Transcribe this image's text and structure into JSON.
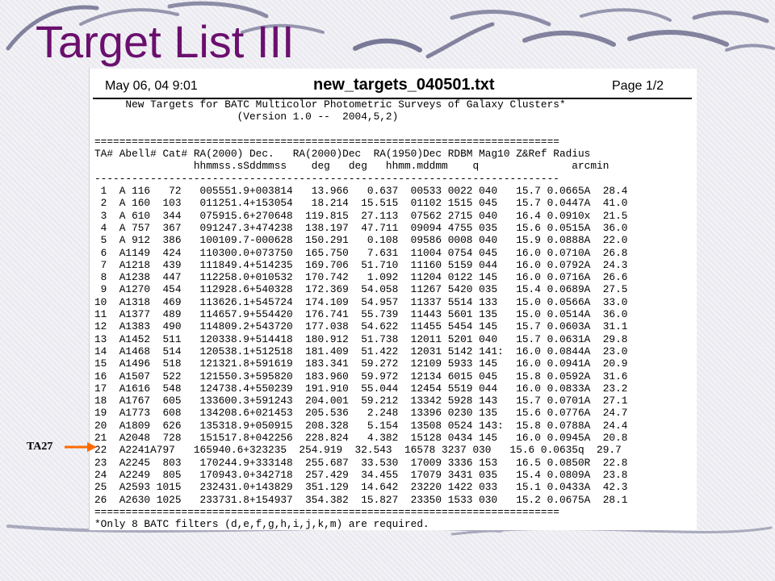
{
  "slide": {
    "title": "Target List III"
  },
  "document": {
    "date": "May 06, 04 9:01",
    "filename": "new_targets_040501.txt",
    "page": "Page 1/2",
    "lines": [
      "     New Targets for BATC Multicolor Photometric Surveys of Galaxy Clusters*",
      "                       (Version 1.0 --  2004,5,2)",
      "",
      "===========================================================================",
      "TA# Abell# Cat# RA(2000) Dec.   RA(2000)Dec  RA(1950)Dec RDBM Mag10 Z&Ref Radius",
      "                hhmmss.sSddmmss    deg   deg   hhmm.mddmm    q               arcmin",
      "---------------------------------------------------------------------------",
      " 1  A 116   72   005551.9+003814   13.966   0.637  00533 0022 040   15.7 0.0665A  28.4",
      " 2  A 160  103   011251.4+153054   18.214  15.515  01102 1515 045   15.7 0.0447A  41.0",
      " 3  A 610  344   075915.6+270648  119.815  27.113  07562 2715 040   16.4 0.0910x  21.5",
      " 4  A 757  367   091247.3+474238  138.197  47.711  09094 4755 035   15.6 0.0515A  36.0",
      " 5  A 912  386   100109.7-000628  150.291   0.108  09586 0008 040   15.9 0.0888A  22.0",
      " 6  A1149  424   110300.0+073750  165.750   7.631  11004 0754 045   16.0 0.0710A  26.8",
      " 7  A1218  439   111849.4+514235  169.706  51.710  11160 5159 044   16.0 0.0792A  24.3",
      " 8  A1238  447   112258.0+010532  170.742   1.092  11204 0122 145   16.0 0.0716A  26.6",
      " 9  A1270  454   112928.6+540328  172.369  54.058  11267 5420 035   15.4 0.0689A  27.5",
      "10  A1318  469   113626.1+545724  174.109  54.957  11337 5514 133   15.0 0.0566A  33.0",
      "11  A1377  489   114657.9+554420  176.741  55.739  11443 5601 135   15.0 0.0514A  36.0",
      "12  A1383  490   114809.2+543720  177.038  54.622  11455 5454 145   15.7 0.0603A  31.1",
      "13  A1452  511   120338.9+514418  180.912  51.738  12011 5201 040   15.7 0.0631A  29.8",
      "14  A1468  514   120538.1+512518  181.409  51.422  12031 5142 141:  16.0 0.0844A  23.0",
      "15  A1496  518   121321.8+591619  183.341  59.272  12109 5933 145   16.0 0.0941A  20.9",
      "16  A1507  522   121550.3+595820  183.960  59.972  12134 6015 045   15.8 0.0592A  31.6",
      "17  A1616  548   124738.4+550239  191.910  55.044  12454 5519 044   16.0 0.0833A  23.2",
      "18  A1767  605   133600.3+591243  204.001  59.212  13342 5928 143   15.7 0.0701A  27.1",
      "19  A1773  608   134208.6+021453  205.536   2.248  13396 0230 135   15.6 0.0776A  24.7",
      "20  A1809  626   135318.9+050915  208.328   5.154  13508 0524 143:  15.8 0.0788A  24.4",
      "21  A2048  728   151517.8+042256  228.824   4.382  15128 0434 145   16.0 0.0945A  20.8",
      "22  A2241A797   165940.6+323235  254.919  32.543  16578 3237 030   15.6 0.0635q  29.7",
      "23  A2245  803   170244.9+333148  255.687  33.530  17009 3336 153   16.5 0.0850R  22.8",
      "24  A2249  805   170943.0+342718  257.429  34.455  17079 3431 035   15.4 0.0809A  23.8",
      "25  A2593 1015   232431.0+143829  351.129  14.642  23220 1422 033   15.1 0.0433A  42.3",
      "26  A2630 1025   233731.8+154937  354.382  15.827  23350 1533 030   15.2 0.0675A  28.1",
      "===========================================================================",
      "*Only 8 BATC filters (d,e,f,g,h,i,j,k,m) are required."
    ]
  },
  "annotation": {
    "label": "TA27",
    "arrow_color": "#ff6a00"
  },
  "colors": {
    "title": "#6b0f6e",
    "swoosh": "#2a2a5a",
    "background": "#eeeef3"
  },
  "icons": {
    "arrow": "arrow-right-icon"
  }
}
